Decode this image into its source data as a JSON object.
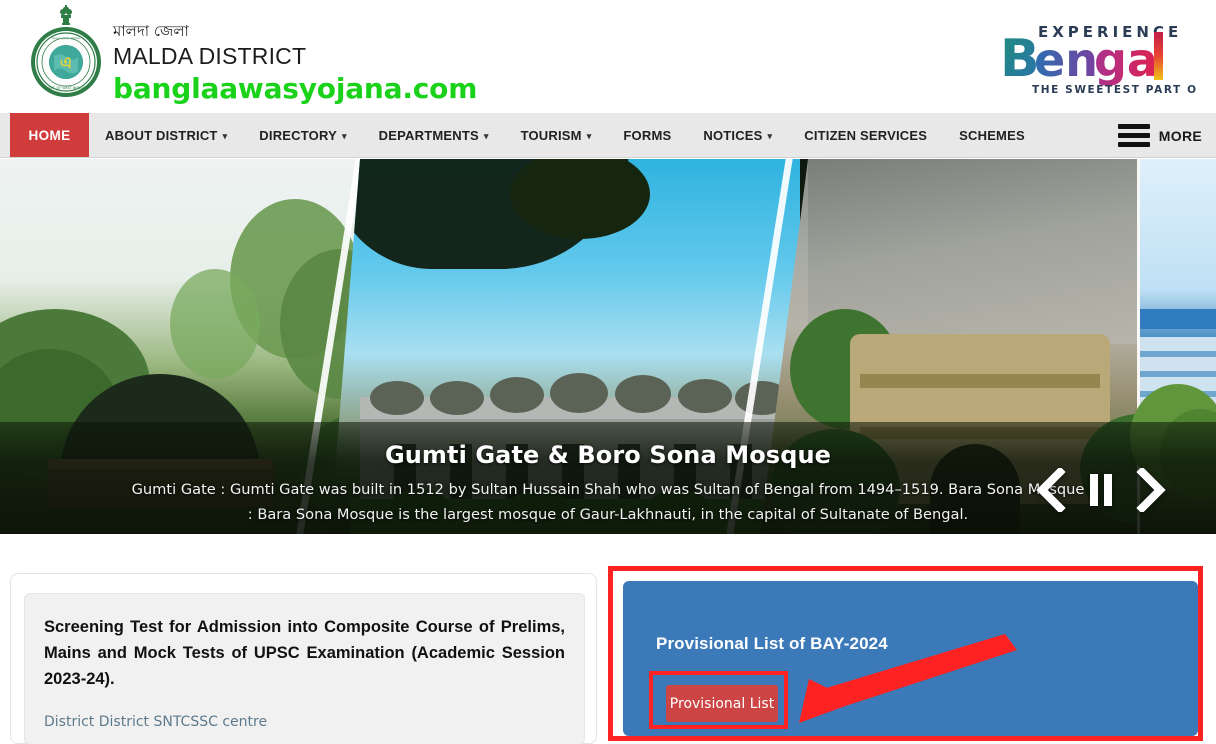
{
  "header": {
    "emblem_icon": "india-state-emblem-icon",
    "seal_icon": "malda-district-seal-icon",
    "title_bengali": "মালদা জেলা",
    "title_english": "MALDA DISTRICT",
    "domain": "banglaawasyojana.com",
    "domain_color": "#19d219",
    "brand_logo": {
      "icon": "experience-bengal-logo-icon",
      "top_text": "EXPERIENCE",
      "word": "Bengal",
      "tagline": "THE SWEETEST PART OF INDIA"
    }
  },
  "nav": {
    "active_color": "#d03c3c",
    "home_label": "HOME",
    "items": [
      {
        "label": "ABOUT DISTRICT",
        "has_caret": true
      },
      {
        "label": "DIRECTORY",
        "has_caret": true
      },
      {
        "label": "DEPARTMENTS",
        "has_caret": true
      },
      {
        "label": "TOURISM",
        "has_caret": true
      },
      {
        "label": "FORMS",
        "has_caret": false
      },
      {
        "label": "NOTICES",
        "has_caret": true
      },
      {
        "label": "CITIZEN SERVICES",
        "has_caret": false
      },
      {
        "label": "SCHEMES",
        "has_caret": false
      }
    ],
    "more_label": "MORE",
    "menu_icon": "hamburger-menu-icon"
  },
  "carousel": {
    "caption_title": "Gumti Gate & Boro Sona Mosque",
    "caption_text": "Gumti Gate : Gumti Gate was built in 1512 by Sultan Hussain Shah who was Sultan of Bengal from 1494–1519. Bara Sona Mosque : Bara Sona Mosque is the largest mosque of Gaur-Lakhnauti, in the capital of Sultanate of Bengal.",
    "controls": {
      "prev_icon": "chevron-left-icon",
      "pause_icon": "pause-icon",
      "next_icon": "chevron-right-icon"
    }
  },
  "notice_card": {
    "title": "Screening Test for Admission into Composite Course of Prelims, Mains and Mock Tests of UPSC Examination (Academic Session 2023-24).",
    "link": "District District SNTCSSC centre"
  },
  "highlight_panel": {
    "annotation_color": "#ff2222",
    "panel_color": "#3b79b8",
    "title": "Provisional List of BAY-2024",
    "button_label": "Provisional List",
    "button_color": "#cc4444",
    "arrow_icon": "red-pointer-arrow-icon"
  }
}
